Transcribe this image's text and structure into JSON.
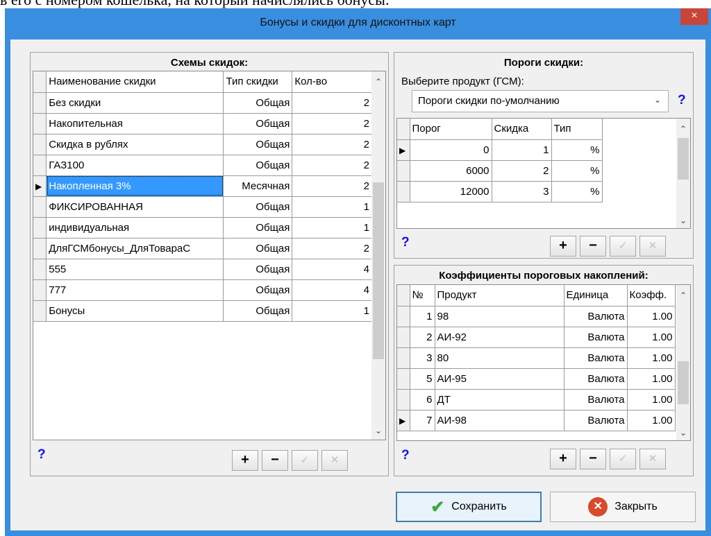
{
  "background_text": "в его с номером кошелька, на который начислялись бонусы.",
  "window": {
    "title": "Бонусы и скидки для дисконтных карт",
    "close_label": "×"
  },
  "schemes": {
    "title": "Схемы скидок:",
    "columns": [
      "Наименование скидки",
      "Тип скидки",
      "Кол-во"
    ],
    "rows": [
      {
        "name": "Без скидки",
        "type": "Общая",
        "count": "2"
      },
      {
        "name": "Накопительная",
        "type": "Общая",
        "count": "2"
      },
      {
        "name": "Скидка в рублях",
        "type": "Общая",
        "count": "2"
      },
      {
        "name": "ГАЗ100",
        "type": "Общая",
        "count": "2"
      },
      {
        "name": "Накопленная 3%",
        "type": "Месячная",
        "count": "2",
        "selected": true
      },
      {
        "name": "ФИКСИРОВАННАЯ",
        "type": "Общая",
        "count": "1"
      },
      {
        "name": "индивидуальная",
        "type": "Общая",
        "count": "1"
      },
      {
        "name": "ДляГСМбонусы_ДляТовараС",
        "type": "Общая",
        "count": "2"
      },
      {
        "name": "555",
        "type": "Общая",
        "count": "4"
      },
      {
        "name": "777",
        "type": "Общая",
        "count": "4"
      },
      {
        "name": "Бонусы",
        "type": "Общая",
        "count": "1"
      }
    ]
  },
  "thresholds": {
    "title": "Пороги скидки:",
    "product_label": "Выберите продукт (ГСМ):",
    "product_value": "Пороги скидки по-умолчанию",
    "columns": [
      "Порог",
      "Скидка",
      "Тип"
    ],
    "rows": [
      {
        "threshold": "0",
        "discount": "1",
        "type": "%",
        "current": true
      },
      {
        "threshold": "6000",
        "discount": "2",
        "type": "%"
      },
      {
        "threshold": "12000",
        "discount": "3",
        "type": "%"
      }
    ]
  },
  "coefficients": {
    "title": "Коэффициенты пороговых накоплений:",
    "columns": [
      "№",
      "Продукт",
      "Единица",
      "Коэфф."
    ],
    "rows": [
      {
        "num": "1",
        "product": "98",
        "unit": "Валюта",
        "coef": "1.00"
      },
      {
        "num": "2",
        "product": "АИ-92",
        "unit": "Валюта",
        "coef": "1.00"
      },
      {
        "num": "3",
        "product": "80",
        "unit": "Валюта",
        "coef": "1.00"
      },
      {
        "num": "5",
        "product": "АИ-95",
        "unit": "Валюта",
        "coef": "1.00"
      },
      {
        "num": "6",
        "product": "ДТ",
        "unit": "Валюта",
        "coef": "1.00"
      },
      {
        "num": "7",
        "product": "АИ-98",
        "unit": "Валюта",
        "coef": "1.00",
        "current": true
      }
    ]
  },
  "toolbar": {
    "help": "?",
    "add": "+",
    "remove": "−",
    "apply": "✓",
    "cancel": "✕"
  },
  "buttons": {
    "save": "Сохранить",
    "close": "Закрыть"
  }
}
